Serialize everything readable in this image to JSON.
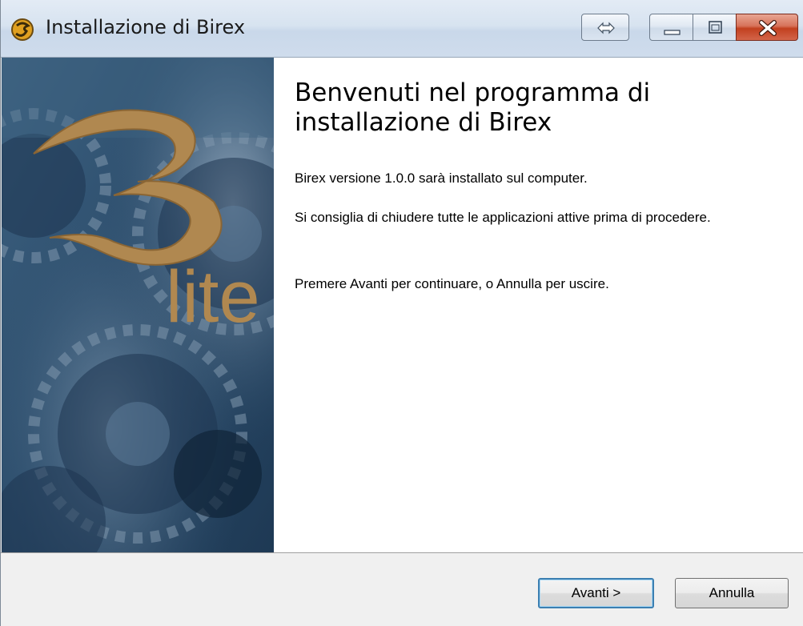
{
  "window": {
    "title": "Installazione di Birex",
    "accent_color": "#c2401f",
    "controls": {
      "swap_icon": "double-arrow-icon",
      "minimize_icon": "minimize-icon",
      "maximize_icon": "maximize-icon",
      "close_icon": "close-icon"
    }
  },
  "banner": {
    "logo_number": "3",
    "logo_word": "lite",
    "logo_color": "#b08850",
    "background_color": "#2c4d6e"
  },
  "content": {
    "heading": "Benvenuti nel programma di installazione di Birex",
    "paragraph_1": "Birex versione 1.0.0 sarà installato sul computer.",
    "paragraph_2": "Si consiglia di chiudere tutte le applicazioni attive prima di procedere.",
    "paragraph_3": "Premere Avanti per continuare, o Annulla per uscire."
  },
  "buttons": {
    "next_label": "Avanti >",
    "cancel_label": "Annulla"
  }
}
